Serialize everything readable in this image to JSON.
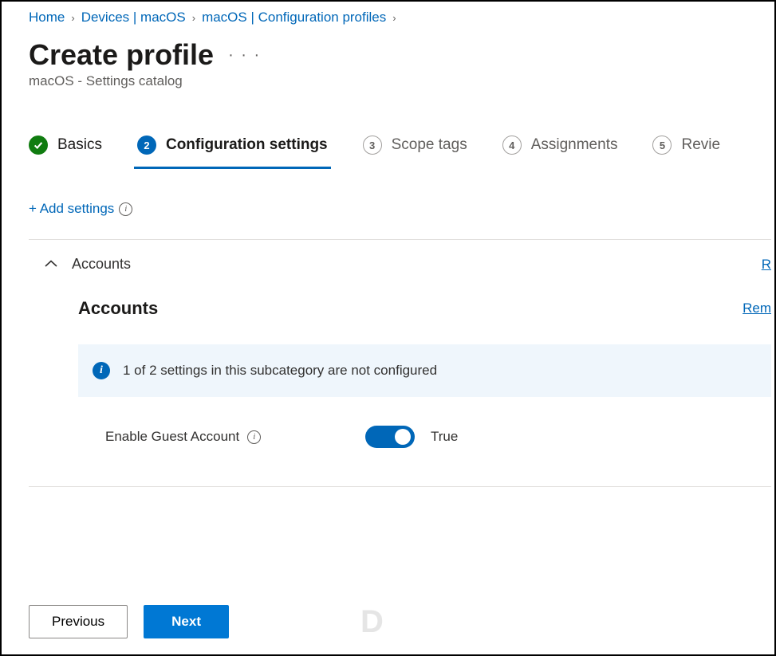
{
  "breadcrumb": {
    "items": [
      "Home",
      "Devices | macOS",
      "macOS | Configuration profiles"
    ]
  },
  "page": {
    "title": "Create profile",
    "subtitle": "macOS - Settings catalog"
  },
  "steps": [
    {
      "num": "✓",
      "label": "Basics",
      "state": "completed"
    },
    {
      "num": "2",
      "label": "Configuration settings",
      "state": "active"
    },
    {
      "num": "3",
      "label": "Scope tags",
      "state": "pending"
    },
    {
      "num": "4",
      "label": "Assignments",
      "state": "pending"
    },
    {
      "num": "5",
      "label": "Revie",
      "state": "pending"
    }
  ],
  "actions": {
    "add_settings": "+ Add settings",
    "remove_category_partial": "R",
    "remove_subcat_partial": "Rem"
  },
  "section": {
    "name": "Accounts",
    "subcategory_title": "Accounts",
    "info_message": "1 of 2 settings in this subcategory are not configured",
    "setting": {
      "label": "Enable Guest Account",
      "value_label": "True",
      "value": true
    }
  },
  "footer": {
    "previous": "Previous",
    "next": "Next"
  },
  "watermark": "D"
}
